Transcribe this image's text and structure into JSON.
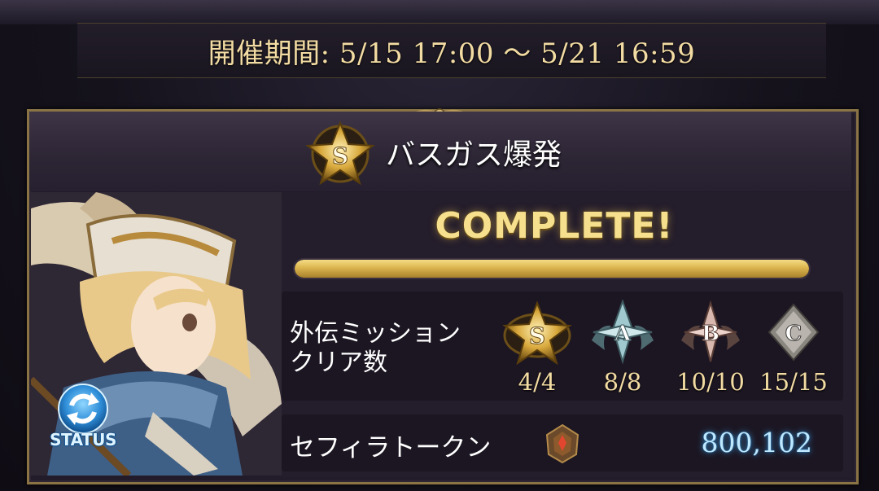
{
  "event": {
    "period_label": "開催期間: 5/15 17:00 〜 5/21 16:59"
  },
  "quest": {
    "rank": "S",
    "title": "バスガス爆発",
    "status_text": "COMPLETE!",
    "progress": 1.0
  },
  "missions": {
    "label_line1": "外伝ミッション",
    "label_line2": "クリア数",
    "ranks": [
      {
        "rank": "S",
        "count": "4/4",
        "icon": "gold-star-rank-icon"
      },
      {
        "rank": "A",
        "count": "8/8",
        "icon": "silver-rank-icon"
      },
      {
        "rank": "B",
        "count": "10/10",
        "icon": "bronze-rank-icon"
      },
      {
        "rank": "C",
        "count": "15/15",
        "icon": "stone-rank-icon"
      }
    ]
  },
  "token": {
    "label": "セフィラトークン",
    "value": "800,102",
    "icon": "sephira-token-icon"
  },
  "status_button": {
    "label": "STATUS"
  },
  "colors": {
    "gold_text": "#f3dca3",
    "frame": "#8a7446",
    "token_value": "#bfe8ff",
    "progress_fill": "#dcb54e"
  }
}
